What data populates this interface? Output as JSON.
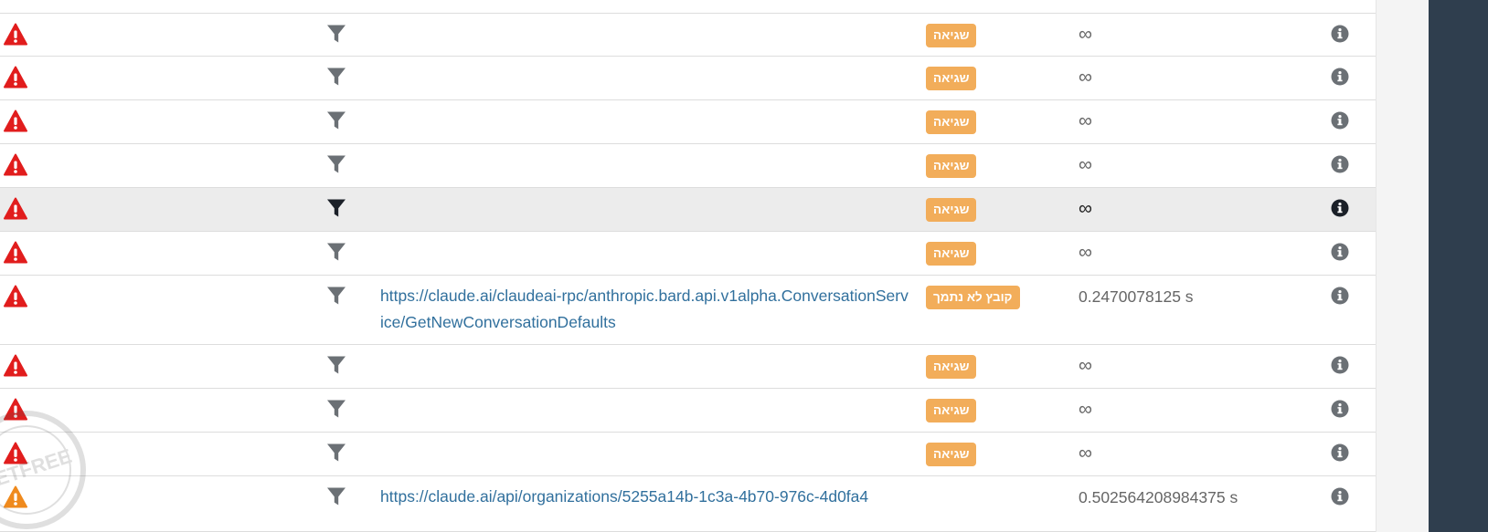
{
  "icons": {
    "alert": "warning-triangle-icon",
    "filter": "filter-funnel-icon",
    "info": "info-circle-icon"
  },
  "colors": {
    "alert_red": "#e11d1d",
    "alert_orange": "#ef8a1e",
    "badge": "#f2ad5a",
    "link": "#31709d",
    "filter": "#6b7075",
    "filter_active": "#1b2028",
    "info": "#6b7075",
    "info_active": "#1b2028",
    "sidebar": "#2f3e4e",
    "row_highlight": "#ececec"
  },
  "rows": [
    {
      "status": "error",
      "url": "",
      "badge": "שגיאה",
      "time": "∞",
      "highlighted": false
    },
    {
      "status": "error",
      "url": "",
      "badge": "שגיאה",
      "time": "∞",
      "highlighted": false
    },
    {
      "status": "error",
      "url": "",
      "badge": "שגיאה",
      "time": "∞",
      "highlighted": false
    },
    {
      "status": "error",
      "url": "",
      "badge": "שגיאה",
      "time": "∞",
      "highlighted": false
    },
    {
      "status": "error",
      "url": "",
      "badge": "שגיאה",
      "time": "∞",
      "highlighted": true
    },
    {
      "status": "error",
      "url": "",
      "badge": "שגיאה",
      "time": "∞",
      "highlighted": false
    },
    {
      "status": "error",
      "url": "https://claude.ai/claudeai-rpc/anthropic.bard.api.v1alpha.ConversationService/GetNewConversationDefaults",
      "badge": "קובץ לא נתמך",
      "time": "0.2470078125 s",
      "highlighted": false
    },
    {
      "status": "error",
      "url": "",
      "badge": "שגיאה",
      "time": "∞",
      "highlighted": false
    },
    {
      "status": "error",
      "url": "",
      "badge": "שגיאה",
      "time": "∞",
      "highlighted": false
    },
    {
      "status": "error",
      "url": "",
      "badge": "שגיאה",
      "time": "∞",
      "highlighted": false
    },
    {
      "status": "warning",
      "url": "https://claude.ai/api/organizations/5255a14b-1c3a-4b70-976c-4d0fa4",
      "badge": "",
      "time": "0.502564208984375 s",
      "highlighted": false
    }
  ]
}
